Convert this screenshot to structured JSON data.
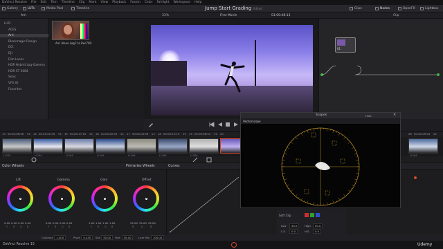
{
  "menubar": [
    "DaVinci Resolve",
    "File",
    "Edit",
    "Trim",
    "Timeline",
    "Clip",
    "Mark",
    "View",
    "Playback",
    "Fusion",
    "Color",
    "Fairlight",
    "Workspace",
    "Help"
  ],
  "toolbar": {
    "left": [
      "Gallery",
      "LUTs",
      "Media Pool",
      "Timeline"
    ],
    "project_title": "Jump Start Grading",
    "project_status": "Edited",
    "right": [
      "Clips",
      "Nodes",
      "OpenFX",
      "Lightbox"
    ]
  },
  "bar2": {
    "lut_folder": "Arri",
    "zoom": "33%",
    "timeline_name": "First Movie",
    "timecode": "01:00:48:13",
    "clip_mode": "Clip"
  },
  "luts": {
    "items": [
      "LUTs",
      "ACES",
      "Arri",
      "Blackmagic Design",
      "DCI",
      "DJI",
      "Film Looks",
      "HDR Hybrid Log-Gamma",
      "HDR ST 2084",
      "Sony",
      "VFX IO",
      "Favorites"
    ],
    "selected_index": 2,
    "thumb_caption": "Arri Alexa LogC to Rec709"
  },
  "node_label": "01",
  "clips": [
    {
      "num": "13",
      "tc": "00:00:06:06",
      "track": "V1",
      "codec": "H.264",
      "c1": "#4a5a7a",
      "c2": "#c8c8c8"
    },
    {
      "num": "14",
      "tc": "00:01:01:05",
      "track": "V1",
      "codec": "H.264",
      "c1": "#3a5aa0",
      "c2": "#e8e8f0"
    },
    {
      "num": "15",
      "tc": "00:00:17:14",
      "track": "V1",
      "codec": "H.264",
      "c1": "#6a7aa8",
      "c2": "#d8d8e0"
    },
    {
      "num": "16",
      "tc": "00:00:20:03",
      "track": "V1",
      "codec": "H.264",
      "c1": "#2a4a8a",
      "c2": "#c8d0e0"
    },
    {
      "num": "17",
      "tc": "00:00:04:06",
      "track": "V1",
      "codec": "H.264",
      "c1": "#8a8a80",
      "c2": "#bcbcb4"
    },
    {
      "num": "18",
      "tc": "00:00:13:15",
      "track": "V1",
      "codec": "H.264",
      "c1": "#3a4a6a",
      "c2": "#9aa8c8"
    },
    {
      "num": "19",
      "tc": "00:00:06:04",
      "track": "V1",
      "codec": "H.264",
      "c1": "#b0b0b0",
      "c2": "#e0e0e0"
    },
    {
      "num": "20",
      "tc": "",
      "track": "",
      "codec": "",
      "c1": "#6a5ab8",
      "c2": "#c0b0f0"
    },
    {
      "num": "26",
      "tc": "00:00:09:04",
      "track": "V1",
      "codec": "H.264",
      "c1": "#4a6a9a",
      "c2": "#d0d8e8"
    }
  ],
  "panels": {
    "color_wheels": "Color Wheels",
    "primaries": "Primaries Wheels",
    "curves": "Curves"
  },
  "wheels": [
    {
      "label": "Lift",
      "values": [
        "0.00",
        "0.00",
        "0.00",
        "0.00"
      ]
    },
    {
      "label": "Gamma",
      "values": [
        "0.00",
        "0.00",
        "0.00",
        "0.00"
      ]
    },
    {
      "label": "Gain",
      "values": [
        "1.00",
        "1.00",
        "1.00",
        "1.00"
      ]
    },
    {
      "label": "Offset",
      "values": [
        "25.00",
        "25.00",
        "25.00"
      ]
    }
  ],
  "wheel_channels": [
    "Y",
    "R",
    "G",
    "B"
  ],
  "offset_channels": [
    "R",
    "G",
    "B"
  ],
  "bottom_controls": [
    {
      "label": "Contrast",
      "value": "1.000"
    },
    {
      "label": "Pivot",
      "value": "0.435"
    },
    {
      "label": "Sat",
      "value": "50.00"
    },
    {
      "label": "Hue",
      "value": "50.00"
    },
    {
      "label": "Lum Mix",
      "value": "100.00"
    }
  ],
  "soft_clip": {
    "title": "Soft Clip",
    "low_label": "Low",
    "low_value": "50.0",
    "high_label": "High",
    "high_value": "50.0",
    "ls_label": "L.S.",
    "ls_value": "0.0",
    "hs_label": "H.S.",
    "hs_value": "0.0"
  },
  "scopes": {
    "title": "Scopes",
    "mode": "Vectorscope",
    "option": "Hide"
  },
  "status": {
    "app": "DaVinci Resolve 15",
    "brand": "Udemy"
  },
  "colors": {
    "accent": "#d24a2a",
    "vector_grid": "#c89a2a",
    "trace": "#ffffff"
  }
}
